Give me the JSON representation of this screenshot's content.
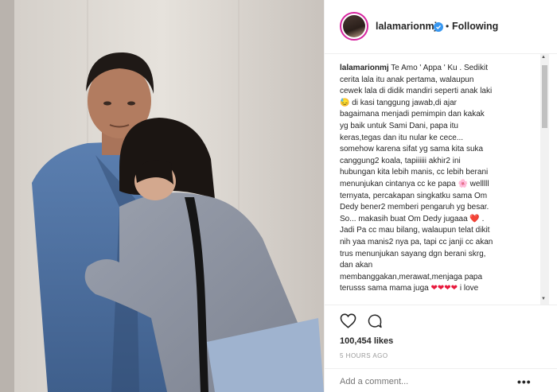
{
  "post": {
    "username": "lalamarionmj",
    "follow_status": "Following",
    "separator": "•",
    "caption_lines": [
      {
        "user": "lalamarionmj",
        "text": " Te Amo ' Appa ' Ku . Sedikit"
      },
      {
        "text": "cerita lala itu anak pertama, walaupun"
      },
      {
        "text": "cewek lala di didik mandiri seperti anak laki"
      },
      {
        "emoji": "😓",
        "text": " di kasi tanggung jawab,di ajar"
      },
      {
        "text": "bagaimana menjadi pemimpin dan kakak"
      },
      {
        "text": "yg baik untuk Sami Dani, papa itu"
      },
      {
        "text": "keras,tegas dan itu nular ke cece..."
      },
      {
        "text": "somehow karena sifat yg sama kita suka"
      },
      {
        "text": "canggung2 koala, tapiiiiii akhir2 ini"
      },
      {
        "text": "hubungan kita lebih manis, cc lebih berani"
      },
      {
        "text": "menunjukan cintanya cc ke papa ",
        "emoji_after": "🌸",
        "text2": " welllll"
      },
      {
        "text": "ternyata, percakapan singkatku sama Om"
      },
      {
        "text": "Dedy bener2 memberi pengaruh yg besar."
      },
      {
        "text": "So... makasih buat Om Dedy jugaaa ",
        "emoji_after": "❤️",
        "text2": " ."
      },
      {
        "text": "Jadi Pa cc mau bilang, walaupun telat dikit"
      },
      {
        "text": "nih yaa manis2 nya pa, tapi cc janji cc akan"
      },
      {
        "text": "trus menunjukan sayang dgn berani skrg,"
      },
      {
        "text": "dan akan"
      },
      {
        "text": "membanggakan,merawat,menjaga papa"
      },
      {
        "text": "terusss sama mama juga ",
        "hearts": 4,
        "text2": " i love"
      }
    ],
    "likes": "100,454 likes",
    "time_ago": "5 HOURS AGO",
    "comment_placeholder": "Add a comment...",
    "more_label": "•••",
    "icons": {
      "like": "heart-icon",
      "comment": "comment-bubble-icon",
      "verified": "verified-badge-icon",
      "more": "more-options-icon"
    },
    "colors": {
      "verified": "#3897f0",
      "heart_emoji": "#e8183c",
      "meta": "#999999"
    }
  }
}
